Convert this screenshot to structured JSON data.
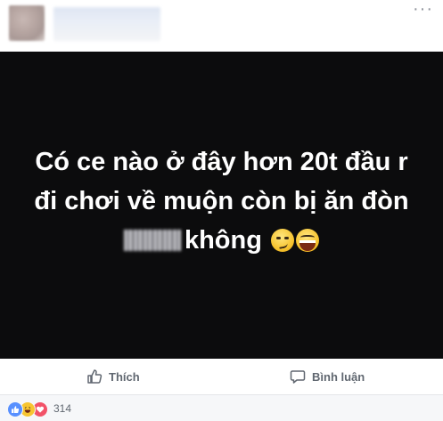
{
  "post": {
    "author_avatar_icon": "blurred-avatar-icon",
    "author_name": "",
    "more_options_glyph": "···",
    "image_text_line1": "Có ce nào ở đây hơn 20t đầu r",
    "image_text_line2": "đi chơi về muộn còn bị ăn đòn",
    "image_text_line3": "không",
    "emojis": [
      "smirk-emoji-icon",
      "grinning-emoji-icon"
    ]
  },
  "actions": {
    "like_label": "Thích",
    "comment_label": "Bình luận"
  },
  "reactions": {
    "icons": [
      "like-reaction-icon",
      "haha-reaction-icon",
      "love-reaction-icon"
    ],
    "count": "314"
  },
  "colors": {
    "image_background": "#0c0c0d",
    "action_text": "#606770",
    "reaction_bar": "#f6f7f9",
    "like_blue": "#5890ff",
    "love_red": "#f25268",
    "haha_yellow": "#f7c531"
  }
}
